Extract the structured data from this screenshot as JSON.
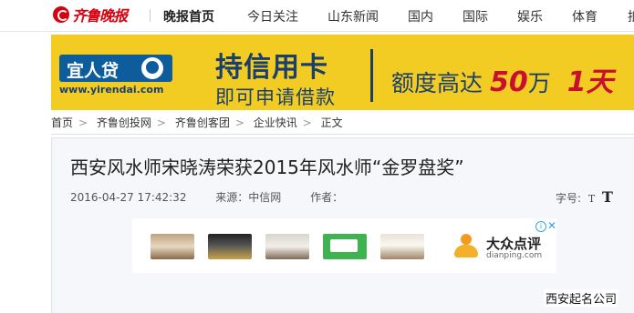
{
  "site": {
    "logo_text": "齐鲁晚报"
  },
  "nav": {
    "items": [
      "晚报首页",
      "今日关注",
      "山东新闻",
      "国内",
      "国际",
      "娱乐",
      "体育",
      "抵"
    ]
  },
  "ad_banner": {
    "brand_name": "宜人贷",
    "brand_url": "www.yirendai.com",
    "headline": "持信用卡",
    "subline": "即可申请借款",
    "amount_prefix": "额度高达",
    "amount_value": "50",
    "amount_unit": "万",
    "amount_tail": "1天"
  },
  "breadcrumb": {
    "items": [
      "首页",
      "齐鲁创投网",
      "齐鲁创客团",
      "企业快讯",
      "正文"
    ],
    "separator": ">"
  },
  "article": {
    "title": "西安风水师宋晓涛荣获2015年风水师“金罗盘奖”",
    "datetime": "2016-04-27 17:42:32",
    "source_label": "来源：",
    "source": "中信网",
    "author_label": "作者：",
    "font_size_label": "字号:",
    "font_small": "T",
    "font_large": "T"
  },
  "ad_strip": {
    "brand_name": "大众点评",
    "brand_url": "dianping.com",
    "info_icon": "info-icon",
    "close_icon": "close-icon",
    "close_glyph": "✕",
    "info_glyph": "i"
  },
  "side_link": "西安起名公司",
  "colors": {
    "brand_red": "#d7000f",
    "banner_yellow": "#f2cc22",
    "banner_navy": "#1a3f6d",
    "accent_red": "#c8102e"
  }
}
